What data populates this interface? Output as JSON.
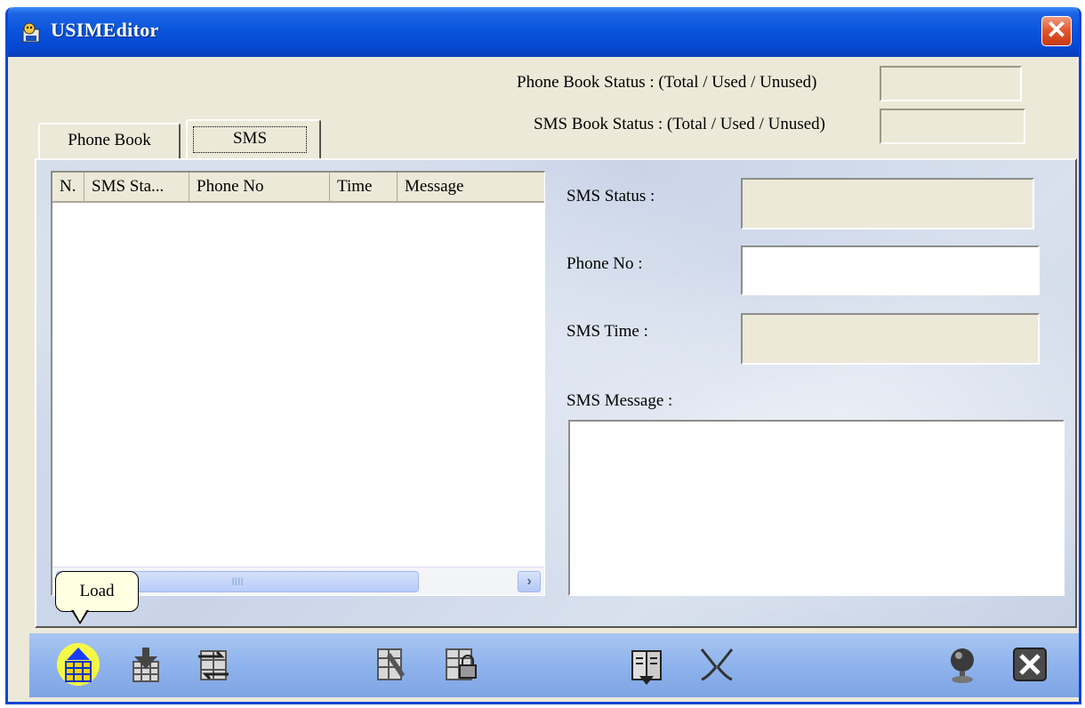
{
  "window": {
    "title": "USIMEditor",
    "close_glyph": "✕"
  },
  "status": {
    "phonebook_label": "Phone Book Status : (Total / Used / Unused)",
    "phonebook_value": "",
    "sms_label": "SMS Book Status : (Total / Used / Unused)",
    "sms_value": ""
  },
  "tabs": [
    {
      "label": "Phone Book",
      "selected": false
    },
    {
      "label": "SMS",
      "selected": true
    }
  ],
  "list": {
    "columns": [
      "N.",
      "SMS Sta...",
      "Phone No",
      "Time",
      "Message"
    ],
    "rows": [],
    "scroll_right_glyph": "›",
    "thumb_grip": "IIII"
  },
  "detail": {
    "sms_status_label": "SMS Status :",
    "sms_status_value": "",
    "phone_no_label": "Phone No :",
    "phone_no_value": "",
    "sms_time_label": "SMS Time :",
    "sms_time_value": "",
    "sms_message_label": "SMS Message :",
    "sms_message_value": ""
  },
  "tooltip": {
    "text": "Load"
  },
  "toolbar": {
    "buttons": [
      {
        "icon": "load-icon"
      },
      {
        "icon": "save-icon"
      },
      {
        "icon": "transfer-icon"
      },
      {
        "icon": "edit-icon"
      },
      {
        "icon": "lock-icon"
      },
      {
        "icon": "book-icon"
      },
      {
        "icon": "disconnect-icon"
      },
      {
        "icon": "globe-icon"
      },
      {
        "icon": "exit-icon"
      }
    ]
  },
  "colors": {
    "titlebar": "#0a56dc",
    "panel_bg": "#c9d4e8",
    "toolbar_bg": "#8fb3ec",
    "load_highlight": "#ffff33"
  }
}
